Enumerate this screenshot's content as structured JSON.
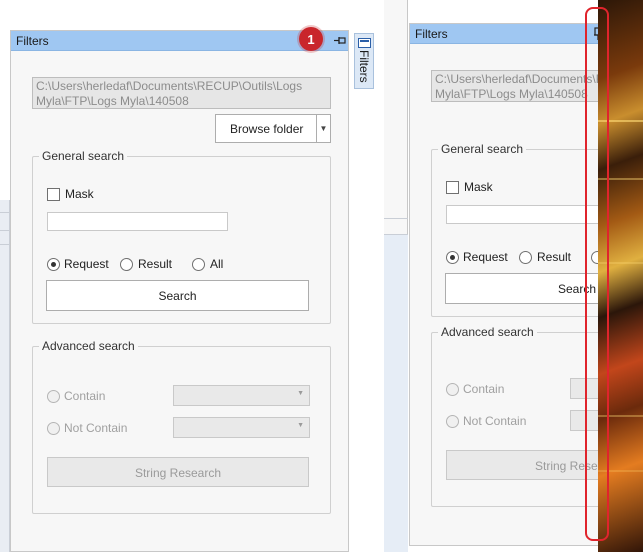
{
  "left_panel": {
    "title": "Filters",
    "pin_icon": "pin-icon",
    "badge": "1",
    "side_tab_label": "Filters",
    "path_line1": "C:\\Users\\herledaf\\Documents\\RECUP\\Outils\\Logs",
    "path_line2": "Myla\\FTP\\Logs Myla\\140508",
    "browse_label": "Browse folder",
    "general_search": {
      "legend": "General search",
      "mask_label": "Mask",
      "mask_value": "",
      "radio_request": "Request",
      "radio_result": "Result",
      "radio_all": "All",
      "search_button": "Search"
    },
    "advanced_search": {
      "legend": "Advanced search",
      "contain_label": "Contain",
      "not_contain_label": "Not Contain",
      "string_research": "String Research"
    }
  },
  "right_panel": {
    "title": "Filters",
    "pin_icon": "pin-icon",
    "path_line1": "C:\\Users\\herledaf\\Documents\\RE",
    "path_line2": "Myla\\FTP\\Logs Myla\\140508",
    "general_search": {
      "legend": "General search",
      "mask_label": "Mask",
      "radio_request": "Request",
      "radio_result": "Result",
      "search_button": "Search"
    },
    "advanced_search": {
      "legend": "Advanced search",
      "contain_label": "Contain",
      "not_contain_label": "Not Contain",
      "string_research": "String Researc"
    }
  },
  "colors": {
    "header_blue": "#9fc7f2",
    "badge_red": "#c9262b",
    "highlight_red": "#e0242c"
  }
}
